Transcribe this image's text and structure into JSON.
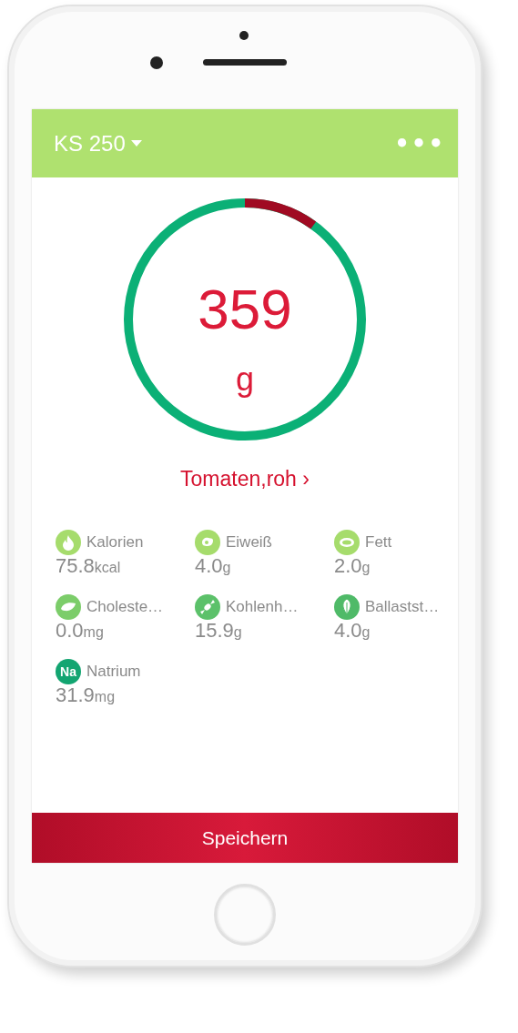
{
  "header": {
    "device": "KS 250",
    "menu": "•••"
  },
  "gauge": {
    "value": "359",
    "unit": "g"
  },
  "food": {
    "name": "Tomaten,roh",
    "chevron": "›"
  },
  "nutrients": [
    {
      "kind": "flame",
      "label": "Kalorien",
      "value": "75.8",
      "unit": "kcal",
      "color": "#a6dc6c"
    },
    {
      "kind": "egg",
      "label": "Eiweiß",
      "value": "4.0",
      "unit": "g",
      "color": "#a6dc6c"
    },
    {
      "kind": "meat",
      "label": "Fett",
      "value": "2.0",
      "unit": "g",
      "color": "#a6dc6c"
    },
    {
      "kind": "liver",
      "label": "Choleste…",
      "value": "0.0",
      "unit": "mg",
      "color": "#7ccd6a"
    },
    {
      "kind": "candy",
      "label": "Kohlenh…",
      "value": "15.9",
      "unit": "g",
      "color": "#5cc16a"
    },
    {
      "kind": "leaf",
      "label": "Ballastst…",
      "value": "4.0",
      "unit": "g",
      "color": "#4fba68"
    },
    {
      "kind": "text",
      "icon_text": "Na",
      "label": "Natrium",
      "value": "31.9",
      "unit": "mg",
      "color": "#13a571"
    }
  ],
  "save_button": "Speichern"
}
